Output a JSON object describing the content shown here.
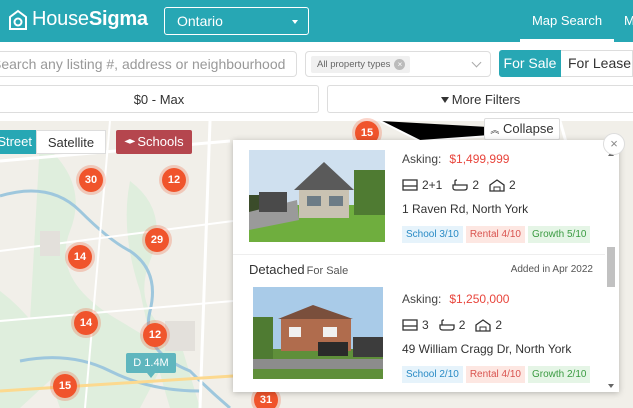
{
  "header": {
    "logo_prefix": "House",
    "logo_suffix": "Sigma",
    "province": "Ontario",
    "nav_map_search": "Map Search",
    "nav_more": "M",
    "brand_color": "#27a7b4"
  },
  "search": {
    "placeholder": "Search any listing #, address or neighbourhood",
    "property_type_chip": "All property types",
    "for_sale": "For Sale",
    "for_lease": "For Lease"
  },
  "filters": {
    "price": "$0 - Max",
    "more_filters": "More Filters"
  },
  "map": {
    "street_label": "Street",
    "satellite_label": "Satellite",
    "schools_label": "Schools",
    "collapse_label": "Collapse",
    "clusters": [
      "15",
      "30",
      "12",
      "29",
      "14",
      "14",
      "12",
      "15",
      "31"
    ],
    "price_pin": "D 1.4M"
  },
  "listings": [
    {
      "type": "",
      "status": "",
      "asking_label": "Asking:",
      "price": "$1,499,999",
      "beds": "2+1",
      "baths": "2",
      "parking": "2",
      "address": "1 Raven Rd, North York",
      "school": "School 3/10",
      "rental": "Rental 4/10",
      "growth": "Growth 5/10"
    },
    {
      "type": "Detached",
      "status": "For Sale",
      "added": "Added in Apr 2022",
      "asking_label": "Asking:",
      "price": "$1,250,000",
      "beds": "3",
      "baths": "2",
      "parking": "2",
      "address": "49 William Cragg Dr, North York",
      "school": "School 2/10",
      "rental": "Rental 4/10",
      "growth": "Growth 2/10"
    }
  ]
}
